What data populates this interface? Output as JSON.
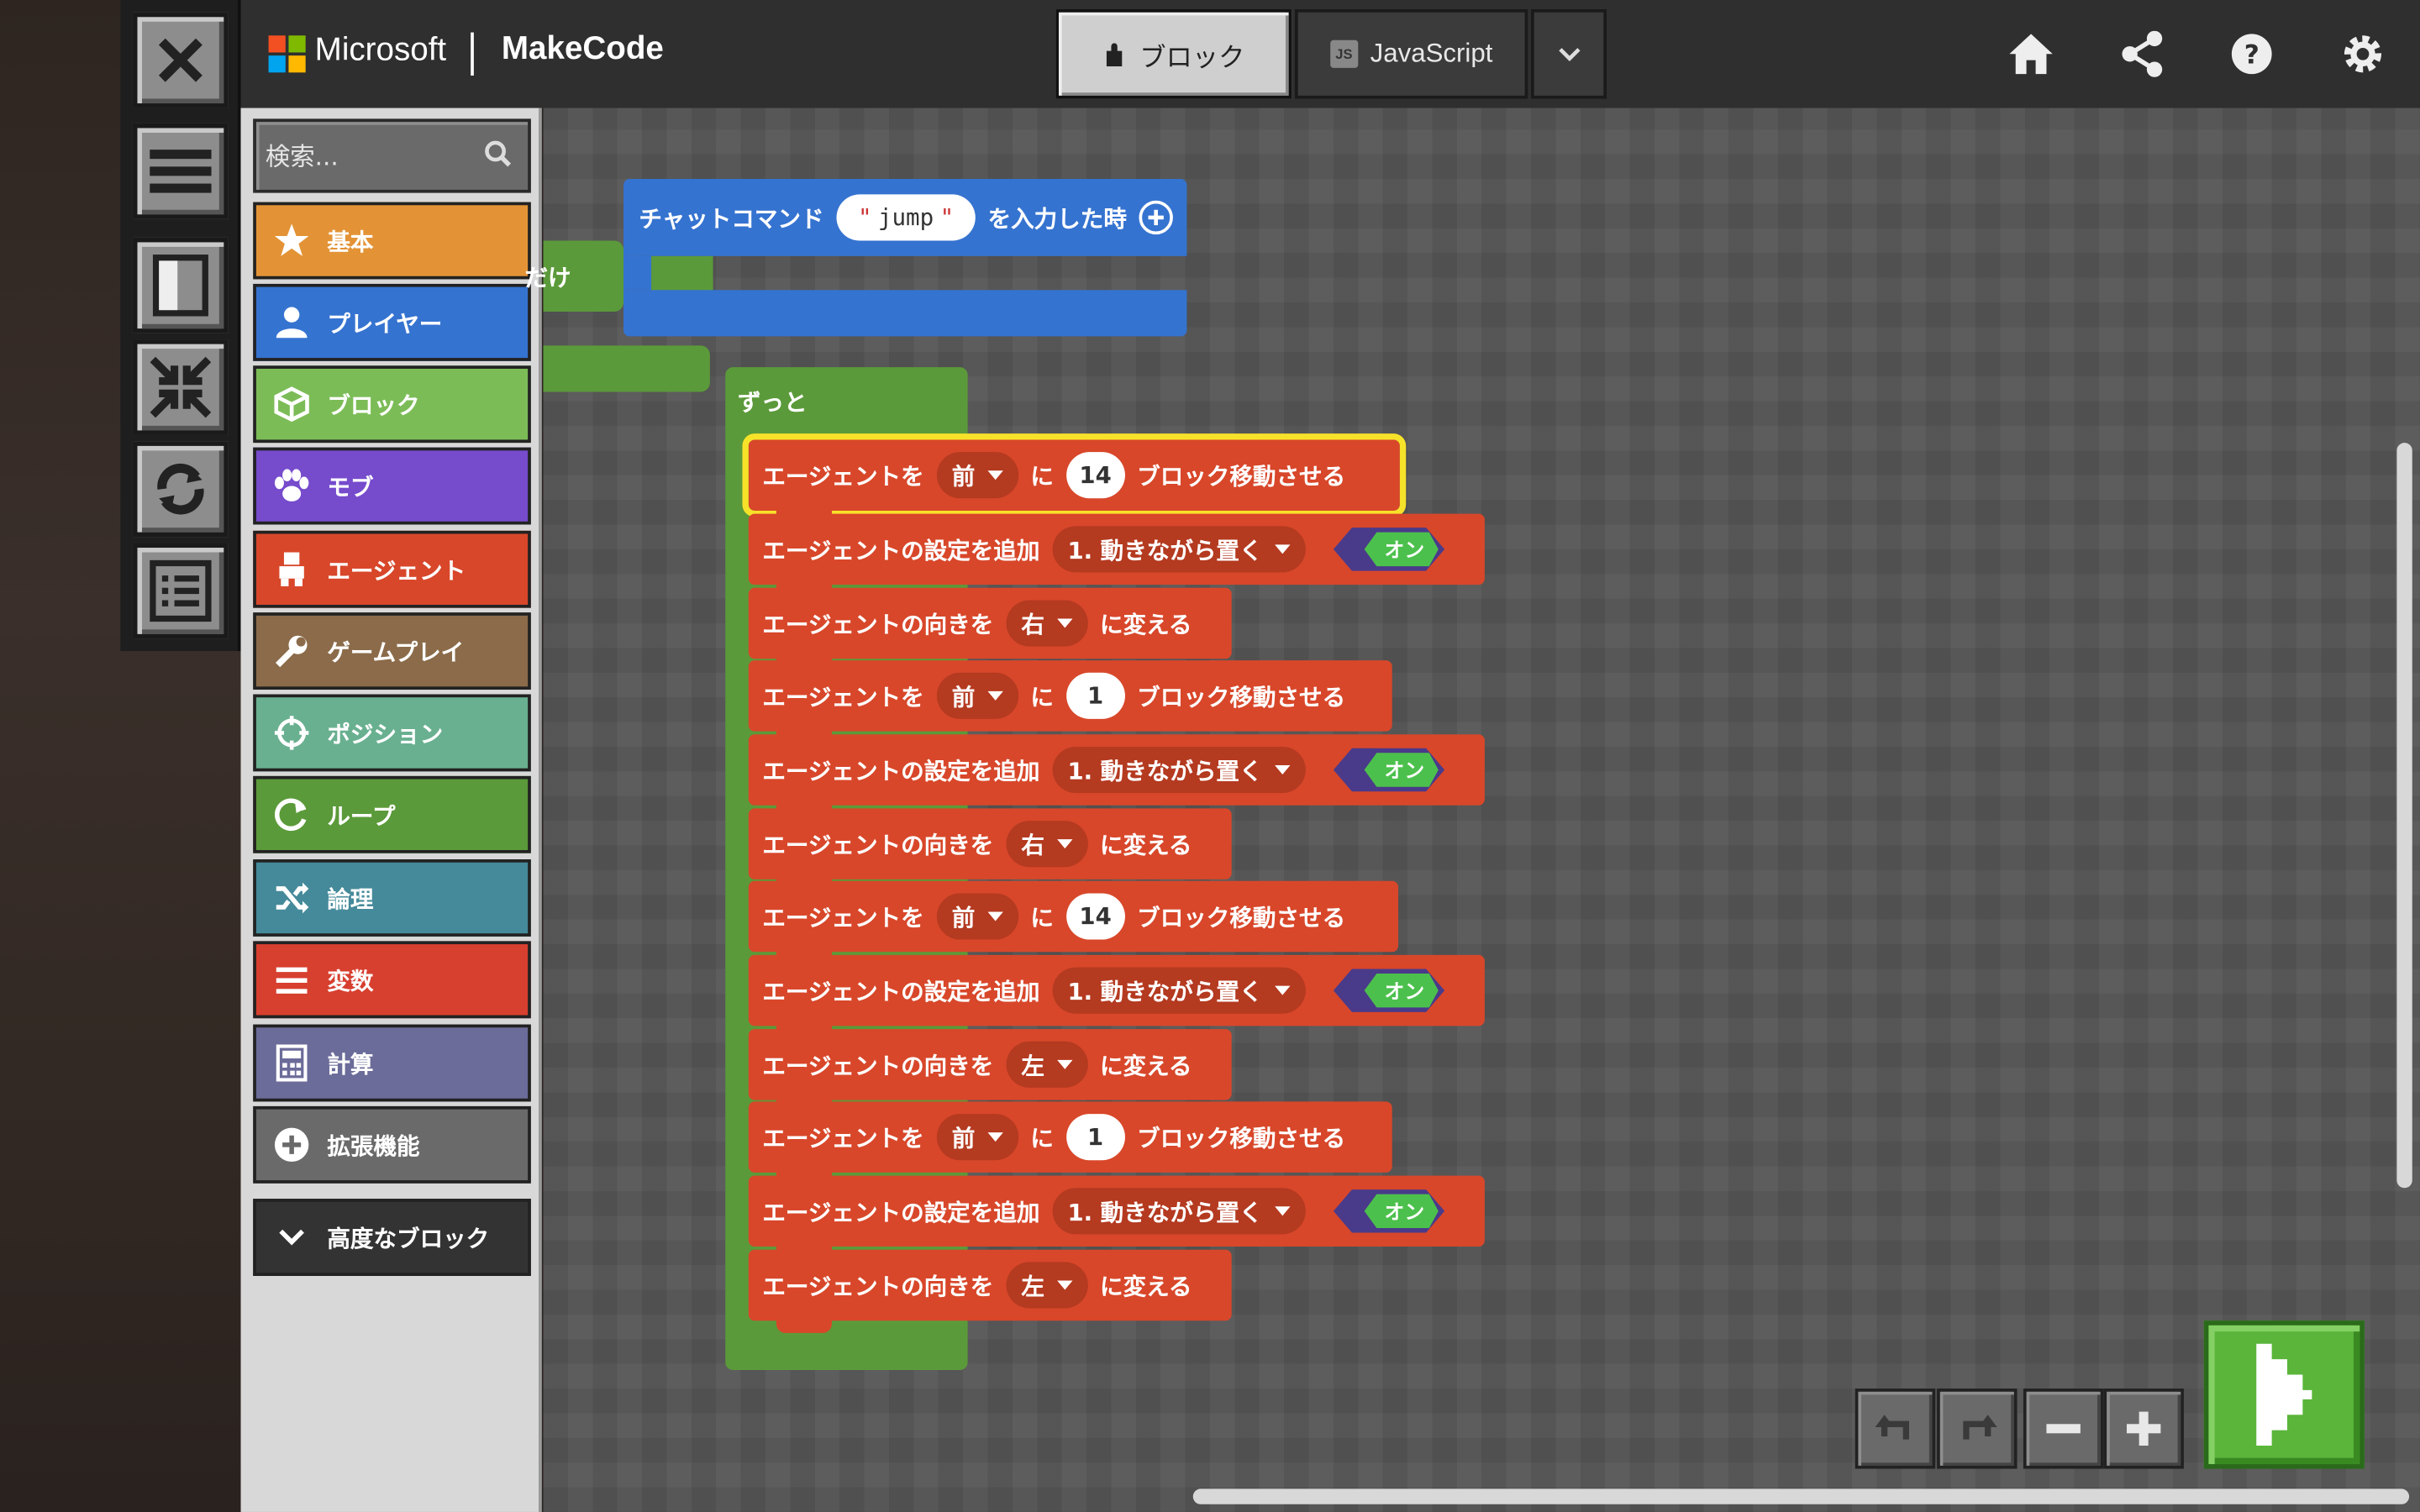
{
  "header": {
    "brand_microsoft": "Microsoft",
    "brand_makecode": "MakeCode",
    "tab_blocks": "ブロック",
    "tab_js": "JavaScript",
    "icons": [
      "home-icon",
      "share-icon",
      "help-icon",
      "settings-icon"
    ]
  },
  "search": {
    "placeholder": "検索..."
  },
  "categories": [
    {
      "label": "基本",
      "color": "#e39336",
      "icon": "star-icon"
    },
    {
      "label": "プレイヤー",
      "color": "#3573d0",
      "icon": "person-icon"
    },
    {
      "label": "ブロック",
      "color": "#7cbc57",
      "icon": "cube-icon"
    },
    {
      "label": "モブ",
      "color": "#764bcc",
      "icon": "paw-icon"
    },
    {
      "label": "エージェント",
      "color": "#d8472a",
      "icon": "agent-icon"
    },
    {
      "label": "ゲームプレイ",
      "color": "#8b6b4a",
      "icon": "wrench-icon"
    },
    {
      "label": "ポジション",
      "color": "#69b090",
      "icon": "crosshair-icon"
    },
    {
      "label": "ループ",
      "color": "#5b9a3a",
      "icon": "loop-icon"
    },
    {
      "label": "論理",
      "color": "#458a9a",
      "icon": "shuffle-icon"
    },
    {
      "label": "変数",
      "color": "#d73f2f",
      "icon": "list-icon"
    },
    {
      "label": "計算",
      "color": "#6c6c9a",
      "icon": "calculator-icon"
    },
    {
      "label": "拡張機能",
      "color": "#6a6a6a",
      "icon": "plus-circle-icon"
    }
  ],
  "advanced": {
    "label": "高度なブロック"
  },
  "workspace": {
    "partial_text": "だけ",
    "event": {
      "prefix": "チャットコマンド",
      "command": "jump",
      "suffix": "を入力した時"
    },
    "forever": "ずっと",
    "blocks": [
      {
        "kind": "move",
        "pre": "エージェントを",
        "sel": "前",
        "mid": "に",
        "num": "14",
        "post": "ブロック移動させる"
      },
      {
        "kind": "setting",
        "pre": "エージェントの設定を追加",
        "sel": "1. 動きながら置く",
        "toggle": "オン"
      },
      {
        "kind": "turn",
        "pre": "エージェントの向きを",
        "sel": "右",
        "post": "に変える"
      },
      {
        "kind": "move",
        "pre": "エージェントを",
        "sel": "前",
        "mid": "に",
        "num": "1",
        "post": "ブロック移動させる"
      },
      {
        "kind": "setting",
        "pre": "エージェントの設定を追加",
        "sel": "1. 動きながら置く",
        "toggle": "オン"
      },
      {
        "kind": "turn",
        "pre": "エージェントの向きを",
        "sel": "右",
        "post": "に変える"
      },
      {
        "kind": "move",
        "pre": "エージェントを",
        "sel": "前",
        "mid": "に",
        "num": "14",
        "post": "ブロック移動させる"
      },
      {
        "kind": "setting",
        "pre": "エージェントの設定を追加",
        "sel": "1. 動きながら置く",
        "toggle": "オン"
      },
      {
        "kind": "turn",
        "pre": "エージェントの向きを",
        "sel": "左",
        "post": "に変える"
      },
      {
        "kind": "move",
        "pre": "エージェントを",
        "sel": "前",
        "mid": "に",
        "num": "1",
        "post": "ブロック移動させる"
      },
      {
        "kind": "setting",
        "pre": "エージェントの設定を追加",
        "sel": "1. 動きながら置く",
        "toggle": "オン"
      },
      {
        "kind": "turn",
        "pre": "エージェントの向きを",
        "sel": "左",
        "post": "に変える"
      }
    ]
  },
  "colors": {
    "agent": "#d8472a",
    "loop": "#5b9a3a",
    "player": "#3573d0",
    "highlight": "#f7e22a"
  }
}
